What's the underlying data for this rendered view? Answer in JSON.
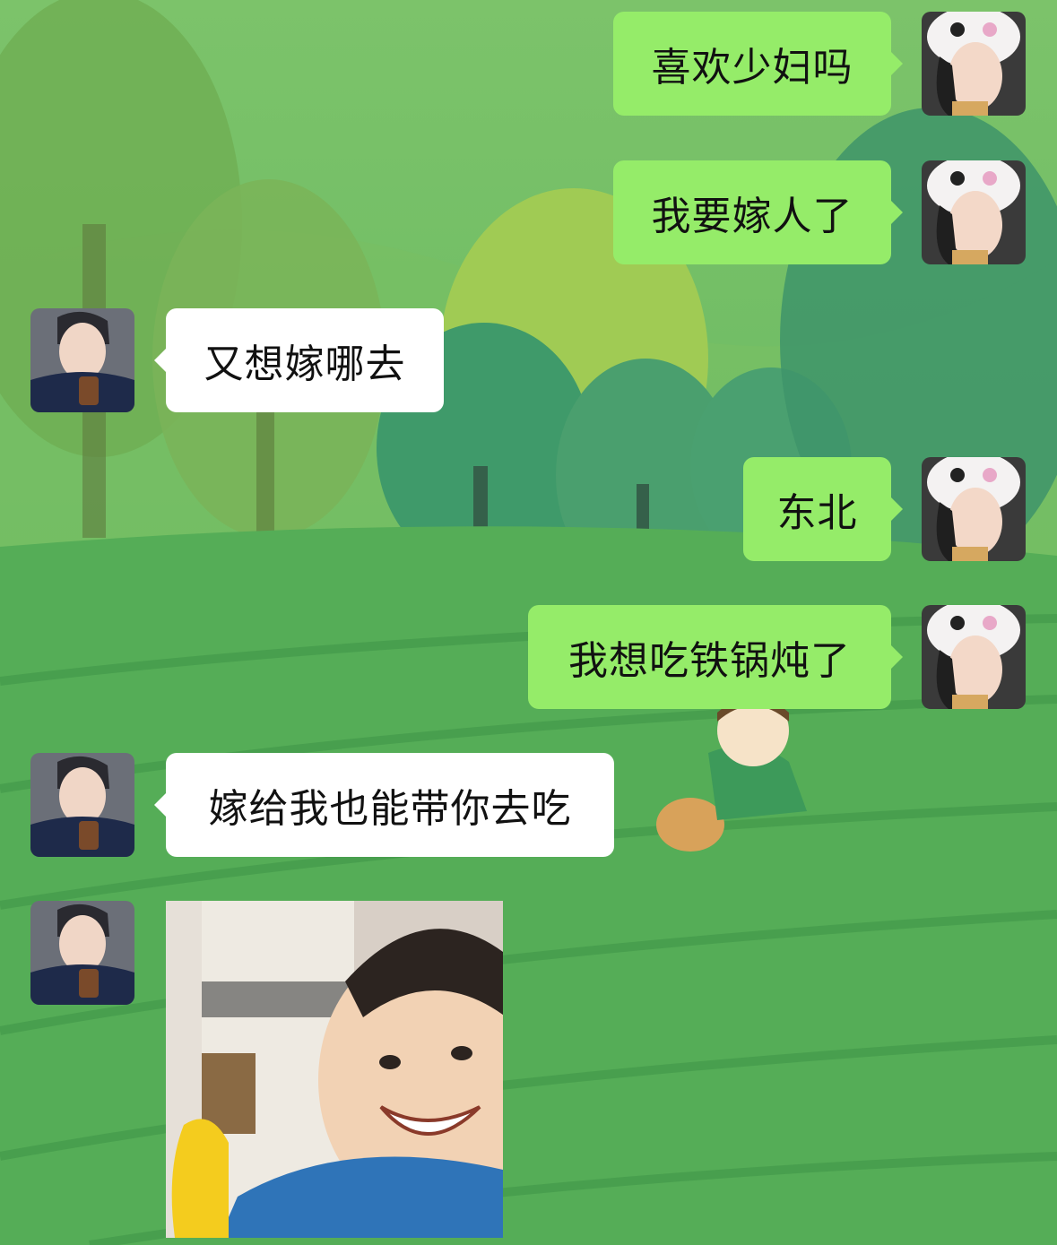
{
  "colors": {
    "sent_bubble": "#95ec69",
    "received_bubble": "#ffffff",
    "background": "#5fb45a"
  },
  "messages": [
    {
      "side": "sent",
      "text": "喜欢少妇吗"
    },
    {
      "side": "sent",
      "text": "我要嫁人了"
    },
    {
      "side": "received",
      "text": "又想嫁哪去"
    },
    {
      "side": "sent",
      "text": "东北"
    },
    {
      "side": "sent",
      "text": "我想吃铁锅炖了"
    },
    {
      "side": "received",
      "text": "嫁给我也能带你去吃"
    },
    {
      "side": "received",
      "type": "image",
      "icon": "smiling-child-with-banana-photo"
    }
  ],
  "avatars": {
    "sent": "girl-in-white-panda-hat-avatar",
    "received": "man-in-suit-with-drink-avatar"
  }
}
